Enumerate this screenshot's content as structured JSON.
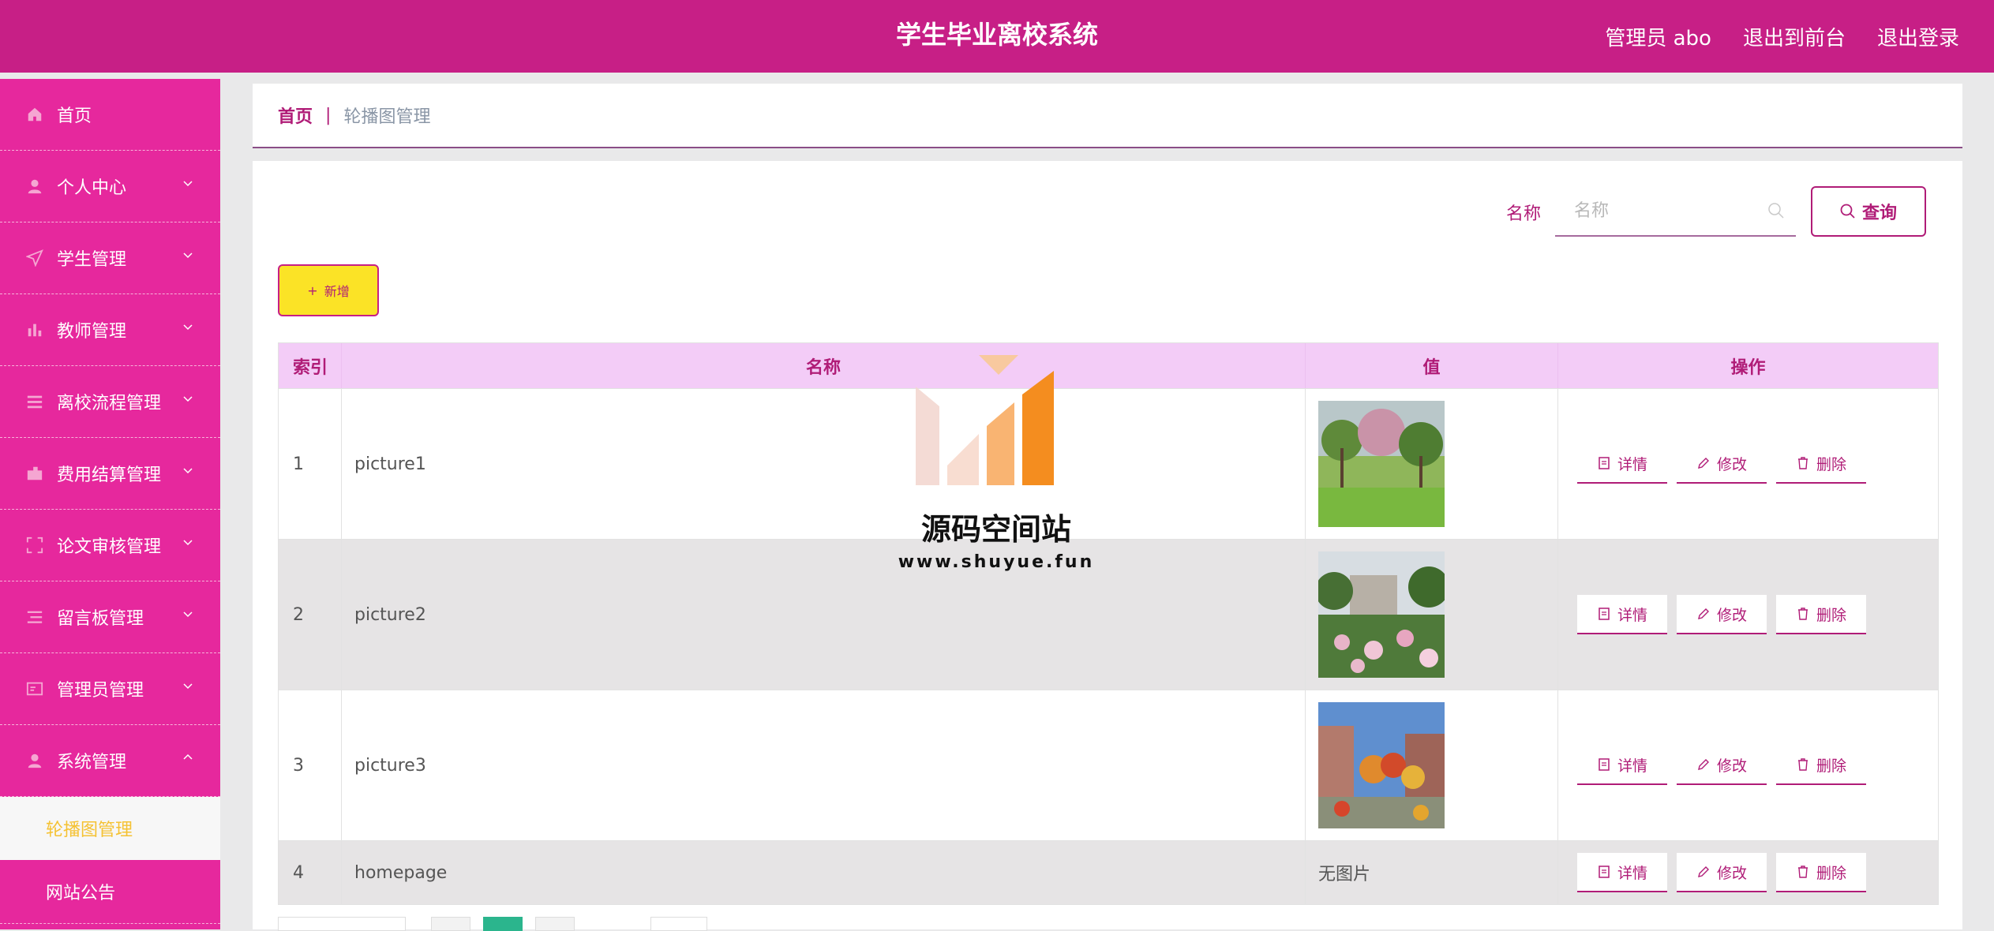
{
  "header": {
    "title": "学生毕业离校系统",
    "admin": "管理员 abo",
    "to_front": "退出到前台",
    "logout": "退出登录"
  },
  "sidebar": {
    "items": [
      {
        "label": "首页",
        "icon": "home-icon"
      },
      {
        "label": "个人中心",
        "icon": "user-icon"
      },
      {
        "label": "学生管理",
        "icon": "send-icon"
      },
      {
        "label": "教师管理",
        "icon": "bar-chart-icon"
      },
      {
        "label": "离校流程管理",
        "icon": "list-icon"
      },
      {
        "label": "费用结算管理",
        "icon": "wallet-icon"
      },
      {
        "label": "论文审核管理",
        "icon": "scan-icon"
      },
      {
        "label": "留言板管理",
        "icon": "menu-icon"
      },
      {
        "label": "管理员管理",
        "icon": "card-icon"
      },
      {
        "label": "系统管理",
        "icon": "user-icon"
      }
    ],
    "sub_items": [
      "轮播图管理",
      "网站公告"
    ]
  },
  "breadcrumb": {
    "home": "首页",
    "sep": "|",
    "current": "轮播图管理"
  },
  "search": {
    "label": "名称",
    "placeholder": "名称",
    "button": "查询"
  },
  "toolbar": {
    "add_label": "新增"
  },
  "table": {
    "headers": [
      "索引",
      "名称",
      "值",
      "操作"
    ],
    "rows": [
      {
        "index": "1",
        "name": "picture1",
        "value": ""
      },
      {
        "index": "2",
        "name": "picture2",
        "value": ""
      },
      {
        "index": "3",
        "name": "picture3",
        "value": ""
      },
      {
        "index": "4",
        "name": "homepage",
        "value": "无图片"
      }
    ],
    "actions": {
      "detail": "详情",
      "edit": "修改",
      "delete": "删除"
    }
  },
  "watermark": {
    "title": "源码空间站",
    "url": "www.shuyue.fun"
  },
  "colors": {
    "brand": "#c71f86",
    "sidebar": "#e6289d",
    "add_button": "#fbe326",
    "table_header": "#f3ccf7",
    "active_sub": "#f5c233"
  }
}
